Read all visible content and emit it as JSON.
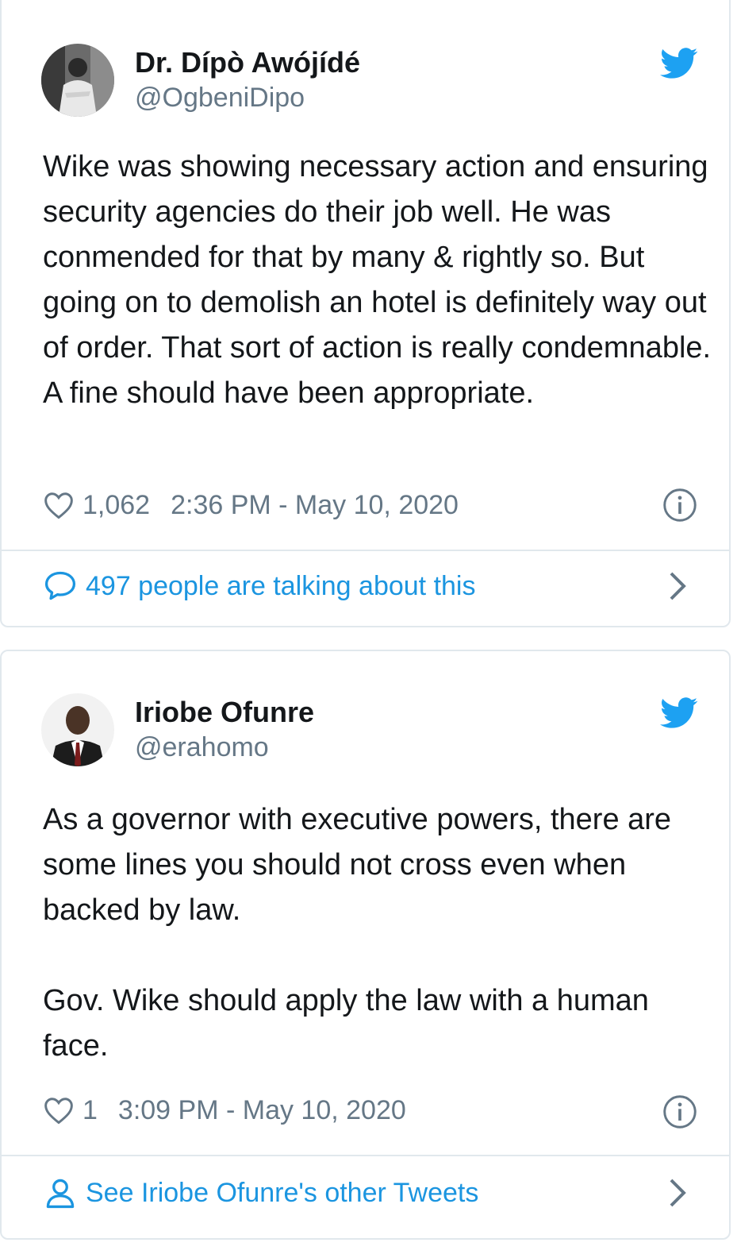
{
  "tweets": [
    {
      "author_name": "Dr. Dípò Awójídé",
      "handle": "@OgbeniDipo",
      "text": "Wike was showing necessary action and ensuring security agencies do their job well. He was conmended for that by many & rightly so. But going on to demolish an hotel is definitely way out of order. That sort of action is really condemnable. A fine should have been appropriate.",
      "likes": "1,062",
      "timestamp": "2:36 PM - May 10, 2020",
      "footer_label": "497 people are talking about this",
      "footer_icon": "speech-bubble-icon"
    },
    {
      "author_name": "Iriobe Ofunre",
      "handle": "@erahomo",
      "text": "As a governor with executive powers, there are some lines you should not cross even when backed by law.\n\nGov. Wike should apply the law with a human face.",
      "likes": "1",
      "timestamp": "3:09 PM - May 10, 2020",
      "footer_label": "See Iriobe Ofunre's other Tweets",
      "footer_icon": "person-icon"
    }
  ],
  "colors": {
    "twitter_blue": "#1da1f2",
    "link_blue": "#1b95e0",
    "secondary_text": "#657786",
    "border": "#e1e8ed"
  }
}
